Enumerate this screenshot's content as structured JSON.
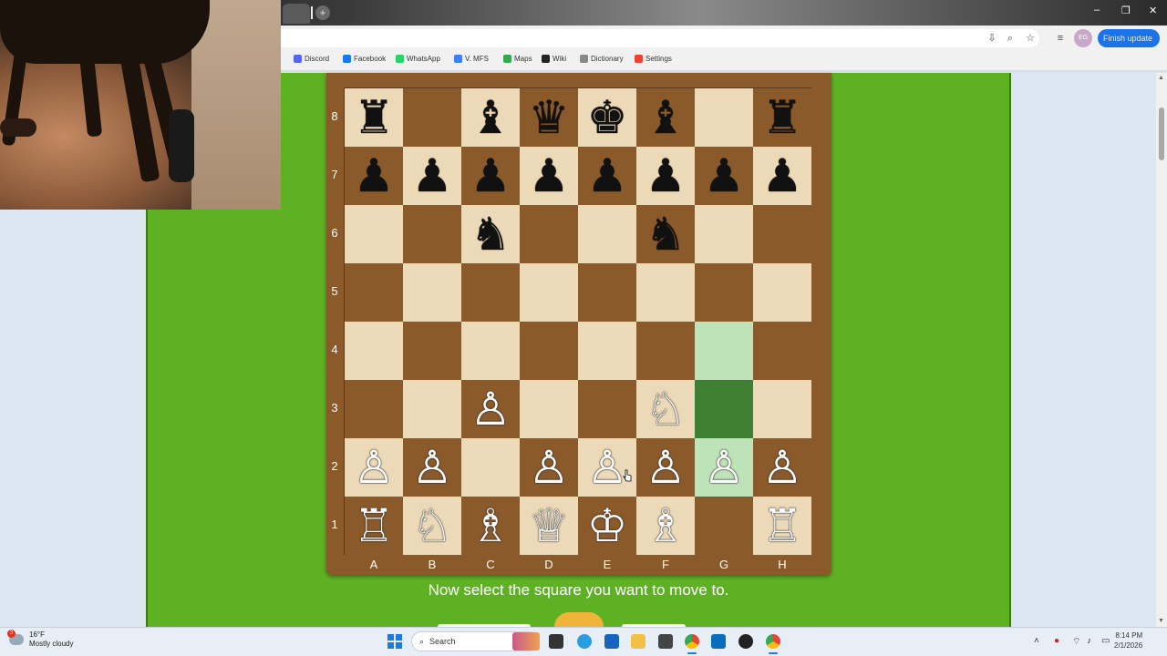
{
  "browser": {
    "new_tab_glyph": "+",
    "window_controls": [
      "–",
      "❐",
      "✕"
    ],
    "update_button": "Finish update",
    "profile_initials": "EG",
    "bookmarks": [
      {
        "label": "Discord",
        "color": "#5865f2"
      },
      {
        "label": "Facebook",
        "color": "#1877f2"
      },
      {
        "label": "WhatsApp",
        "color": "#25d366"
      },
      {
        "label": "V. MFS",
        "color": "#3b82f6"
      },
      {
        "label": "Maps",
        "color": "#34a853"
      },
      {
        "label": "Wiki",
        "color": "#222222"
      },
      {
        "label": "Dictionary",
        "color": "#888888"
      },
      {
        "label": "Settings",
        "color": "#ea4335"
      }
    ]
  },
  "board": {
    "ranks": [
      "8",
      "7",
      "6",
      "5",
      "4",
      "3",
      "2",
      "1"
    ],
    "files": [
      "A",
      "B",
      "C",
      "D",
      "E",
      "F",
      "G",
      "H"
    ],
    "pieces": {
      "8": [
        "♜",
        "",
        "♝",
        "♛",
        "♚",
        "♝",
        "",
        "♜"
      ],
      "7": [
        "♟",
        "♟",
        "♟",
        "♟",
        "♟",
        "♟",
        "♟",
        "♟"
      ],
      "6": [
        "",
        "",
        "♞",
        "",
        "",
        "♞",
        "",
        ""
      ],
      "5": [
        "",
        "",
        "",
        "",
        "",
        "",
        "",
        ""
      ],
      "4": [
        "",
        "",
        "",
        "",
        "",
        "",
        "",
        ""
      ],
      "3": [
        "",
        "",
        "♙",
        "",
        "",
        "♘",
        "",
        ""
      ],
      "2": [
        "♙",
        "♙",
        "",
        "♙",
        "♙",
        "♙",
        "♙",
        "♙"
      ],
      "1": [
        "♖",
        "♘",
        "♗",
        "♕",
        "♔",
        "♗",
        "",
        "♖"
      ]
    },
    "highlighted_squares": [
      "g4",
      "g3",
      "g2"
    ],
    "colors": {
      "light": "#ecd9b8",
      "dark": "#8a5a2b",
      "highlight_light": "#bfe3b8",
      "highlight_dark": "#3f7f33",
      "panel": "#5fb124"
    }
  },
  "instruction": "Now select the square you want to move to.",
  "taskbar": {
    "weather_temp": "16°F",
    "weather_desc": "Mostly cloudy",
    "weather_badge": "3",
    "search_placeholder": "Search",
    "time": "8:14 PM",
    "date": "2/1/2026"
  }
}
